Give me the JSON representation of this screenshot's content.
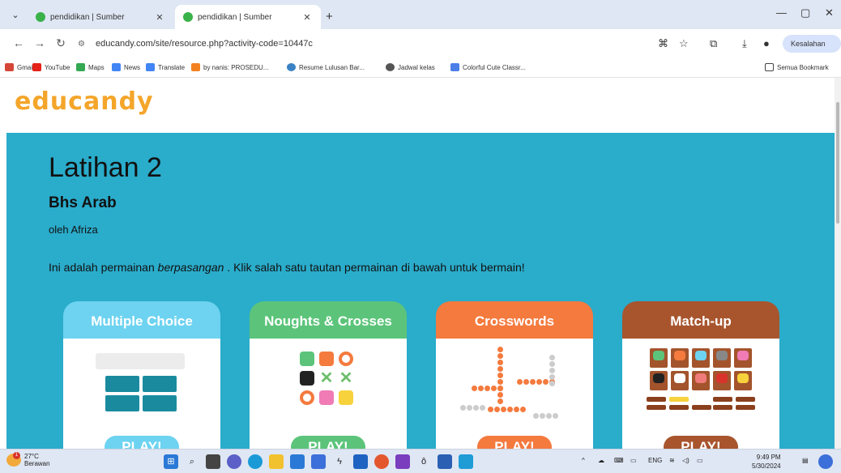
{
  "browser": {
    "tabs": [
      {
        "title": "pendidikan | Sumber",
        "active": false
      },
      {
        "title": "pendidikan | Sumber",
        "active": true
      }
    ],
    "url": "educandy.com/site/resource.php?activity-code=10447c",
    "profile_label": "Kesalahan",
    "bookmarks": [
      "Gmail",
      "YouTube",
      "Maps",
      "News",
      "Translate",
      "by nanis: PROSEDU...",
      "Resume Lulusan Bar...",
      "Jadwal kelas",
      "Colorful Cute Classr..."
    ],
    "all_bookmarks_label": "Semua Bookmark"
  },
  "page": {
    "logo_text": "educandy",
    "title": "Latihan 2",
    "subtitle": "Bhs Arab",
    "author": "oleh Afriza",
    "instruction_pre": "Ini adalah permainan ",
    "instruction_em": "berpasangan",
    "instruction_post": " . Klik salah satu tautan permainan di bawah untuk bermain!",
    "cards": [
      {
        "title": "Multiple Choice",
        "play": "PLAY!",
        "color": "#6dd3f0",
        "play_color": "#6dd3f0"
      },
      {
        "title": "Noughts & Crosses",
        "play": "PLAY!",
        "color": "#5cc47a",
        "play_color": "#5cc47a"
      },
      {
        "title": "Crosswords",
        "play": "PLAY!",
        "color": "#f47a3e",
        "play_color": "#f47a3e"
      },
      {
        "title": "Match-up",
        "play": "PLAY!",
        "color": "#a8552e",
        "play_color": "#a8552e"
      }
    ]
  },
  "taskbar": {
    "temp": "27°C",
    "weather": "Berawan",
    "lang": "ENG",
    "time": "9:49 PM",
    "date": "5/30/2024"
  }
}
